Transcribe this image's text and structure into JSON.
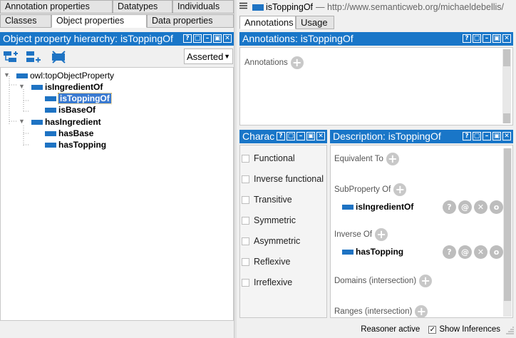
{
  "left_tabs_row1": [
    "Annotation properties",
    "Datatypes",
    "Individuals"
  ],
  "left_tabs_row2": [
    "Classes",
    "Object properties",
    "Data properties"
  ],
  "hierarchy": {
    "title": "Object property hierarchy: isToppingOf",
    "mode": "Asserted",
    "root": "owl:topObjectProperty",
    "nodes": [
      "isIngredientOf",
      "isToppingOf",
      "isBaseOf",
      "hasIngredient",
      "hasBase",
      "hasTopping"
    ],
    "selected": "isToppingOf"
  },
  "entity_header": {
    "name": "isToppingOf",
    "iri": "— http://www.semanticweb.org/michaeldebellis/"
  },
  "right_tabs": [
    "Annotations",
    "Usage"
  ],
  "annotations": {
    "title": "Annotations: isToppingOf",
    "label": "Annotations"
  },
  "characteristics": {
    "title": "Charac",
    "items": [
      "Functional",
      "Inverse functional",
      "Transitive",
      "Symmetric",
      "Asymmetric",
      "Reflexive",
      "Irreflexive"
    ]
  },
  "description": {
    "title": "Description: isToppingOf",
    "equivalent_to": "Equivalent To",
    "subproperty_of": "SubProperty Of",
    "subproperty_value": "isIngredientOf",
    "inverse_of": "Inverse Of",
    "inverse_value": "hasTopping",
    "domains": "Domains (intersection)",
    "ranges": "Ranges (intersection)"
  },
  "status": {
    "reasoner": "Reasoner active",
    "show_inferences": "Show Inferences",
    "show_inferences_checked": true
  },
  "win_buttons": [
    "?",
    "▢",
    "–",
    "▣",
    "✕"
  ],
  "item_buttons": [
    "?",
    "@",
    "✕",
    "o"
  ],
  "plus_glyph": "+"
}
